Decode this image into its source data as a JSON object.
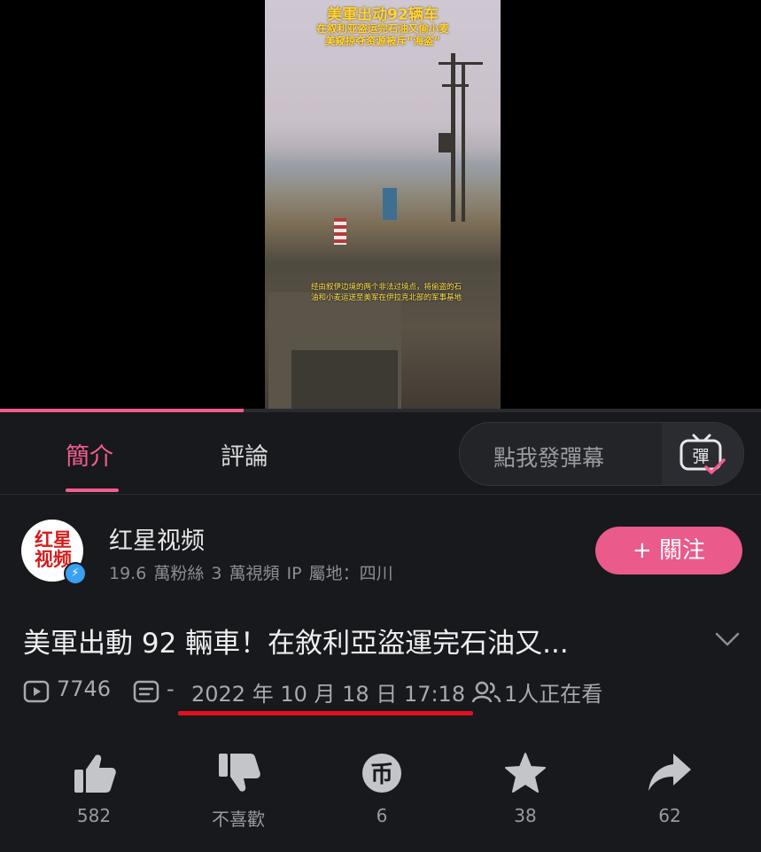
{
  "video": {
    "caption_title": "美軍出动92辆车",
    "caption_line1": "在叙利亚盗运完石油又偷小麦",
    "caption_line2": "美窥掠夺资源被斥“海盗”",
    "subtitle": "经由叙伊边境的两个非法过境点，将偷盗的石油和小麦运送至美军在伊拉克北部的军事基地",
    "progress": 0.32
  },
  "tabs": [
    {
      "label": "簡介",
      "active": true
    },
    {
      "label": "評論",
      "active": false
    }
  ],
  "danmaku": {
    "placeholder": "點我發彈幕",
    "button_icon": "danmaku-icon",
    "button_char": "彈"
  },
  "uploader": {
    "avatar_text": "红星视频",
    "name": "红星视频",
    "stats": "19.6 萬粉絲  3 萬視頻  IP 屬地：四川",
    "follow_label": "+ 關注",
    "verified": true
  },
  "video_info": {
    "title": "美軍出動 92 輛車！在敘利亞盜運完石油又...",
    "views": "7746",
    "danmaku_count": "-",
    "datetime": "2022 年 10 月 18 日  17:18",
    "watching": "1人正在看"
  },
  "actions": [
    {
      "name": "like",
      "label": "582",
      "icon": "thumb-up-icon"
    },
    {
      "name": "dislike",
      "label": "不喜歡",
      "icon": "thumb-down-icon"
    },
    {
      "name": "coin",
      "label": "6",
      "icon": "coin-icon"
    },
    {
      "name": "favorite",
      "label": "38",
      "icon": "star-icon"
    },
    {
      "name": "share",
      "label": "62",
      "icon": "share-icon"
    }
  ],
  "colors": {
    "accent": "#f25d8e",
    "background": "#18191c",
    "highlight_underline": "#e0101e"
  }
}
